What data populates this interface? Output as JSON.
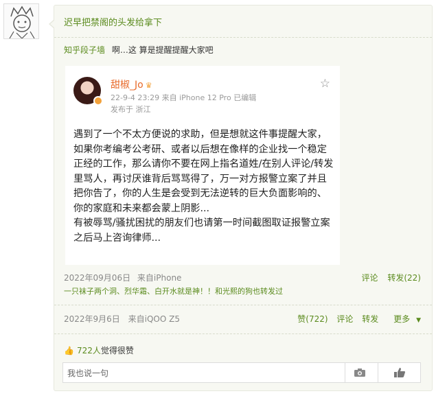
{
  "post": {
    "title": "迟早把禁阁的头发给拿下",
    "repost_user": "知乎段子墙",
    "repost_text": "啊…这 算是提醒提醒大家吧"
  },
  "screenshot": {
    "author": "甜椒_Jo",
    "meta": "22-9-4 23:29  来自 iPhone 12 Pro  已编辑",
    "location": "发布于 浙江",
    "body": "遇到了一个不太方便说的求助，但是想就这件事提醒大家，如果你考编考公考研、或者以后想在像样的企业找一个稳定正经的工作，那么请你不要在网上指名道姓/在别人评论/转发里骂人，再讨厌谁背后骂骂得了，万一对方报警立案了并且把你告了，你的人生是会受到无法逆转的巨大负面影响的、你的家庭和未来都会蒙上阴影...\n有被辱骂/骚扰困扰的朋友们也请第一时间截图取证报警立案之后马上咨询律师..."
  },
  "sub": {
    "date": "2022年09月06日",
    "source": "来自iPhone",
    "comment_label": "评论",
    "forward_label": "转发(22)",
    "forward_text": "一只袜子两个洞、烈华霜、白开水就是神！！和光熙的狗也转发过"
  },
  "main": {
    "date": "2022年9月6日",
    "source": "来自iQOO Z5",
    "like_label": "赞(722)",
    "comment_label": "评论",
    "forward_label": "转发",
    "more_label": "更多"
  },
  "likes": {
    "count": "722人",
    "suffix": "觉得很赞"
  },
  "comment": {
    "placeholder": "我也说一句"
  }
}
